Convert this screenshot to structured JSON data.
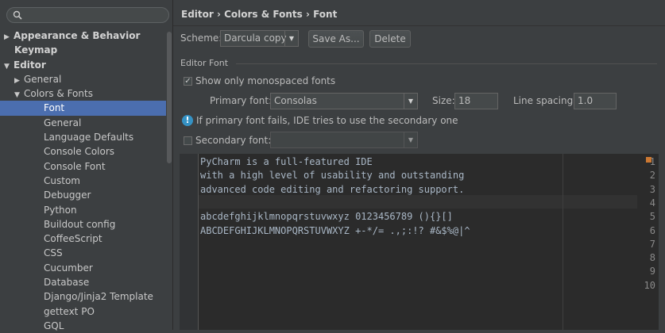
{
  "search": {
    "placeholder": ""
  },
  "tree": [
    {
      "label": "Appearance & Behavior",
      "level": 0,
      "arrow": "▶",
      "bold": true
    },
    {
      "label": "Keymap",
      "level": 0,
      "arrow": "",
      "bold": true
    },
    {
      "label": "Editor",
      "level": 0,
      "arrow": "▼",
      "bold": true
    },
    {
      "label": "General",
      "level": 1,
      "arrow": "▶"
    },
    {
      "label": "Colors & Fonts",
      "level": 1,
      "arrow": "▼"
    },
    {
      "label": "Font",
      "level": 2,
      "arrow": "",
      "selected": true
    },
    {
      "label": "General",
      "level": 2,
      "arrow": ""
    },
    {
      "label": "Language Defaults",
      "level": 2,
      "arrow": ""
    },
    {
      "label": "Console Colors",
      "level": 2,
      "arrow": ""
    },
    {
      "label": "Console Font",
      "level": 2,
      "arrow": ""
    },
    {
      "label": "Custom",
      "level": 2,
      "arrow": ""
    },
    {
      "label": "Debugger",
      "level": 2,
      "arrow": ""
    },
    {
      "label": "Python",
      "level": 2,
      "arrow": ""
    },
    {
      "label": "Buildout config",
      "level": 2,
      "arrow": ""
    },
    {
      "label": "CoffeeScript",
      "level": 2,
      "arrow": ""
    },
    {
      "label": "CSS",
      "level": 2,
      "arrow": ""
    },
    {
      "label": "Cucumber",
      "level": 2,
      "arrow": ""
    },
    {
      "label": "Database",
      "level": 2,
      "arrow": ""
    },
    {
      "label": "Django/Jinja2 Template",
      "level": 2,
      "arrow": ""
    },
    {
      "label": "gettext PO",
      "level": 2,
      "arrow": ""
    },
    {
      "label": "GQL",
      "level": 2,
      "arrow": ""
    }
  ],
  "breadcrumb": "Editor › Colors & Fonts › Font",
  "scheme": {
    "label": "Scheme:",
    "value": "Darcula copy",
    "save_as": "Save As...",
    "delete": "Delete"
  },
  "editor_font": {
    "section_title": "Editor Font",
    "monospaced_label": "Show only monospaced fonts",
    "monospaced_checked": true,
    "primary_label": "Primary font:",
    "primary_value": "Consolas",
    "size_label": "Size:",
    "size_value": "18",
    "spacing_label": "Line spacing:",
    "spacing_value": "1.0",
    "info_text": "If primary font fails, IDE tries to use the secondary one",
    "secondary_label": "Secondary font:",
    "secondary_value": ""
  },
  "preview_lines": [
    "PyCharm is a full-featured IDE",
    "with a high level of usability and outstanding",
    "advanced code editing and refactoring support.",
    "",
    "abcdefghijklmnopqrstuvwxyz 0123456789 (){}[]",
    "ABCDEFGHIJKLMNOPQRSTUVWXYZ +-*/= .,;:!? #&$%@|^",
    "",
    "",
    "",
    ""
  ],
  "line_numbers": [
    "1",
    "2",
    "3",
    "4",
    "5",
    "6",
    "7",
    "8",
    "9",
    "10"
  ],
  "colors": {
    "selection": "#4b6eaf",
    "background": "#3c3f41",
    "editor_bg": "#2b2b2b",
    "accent_marker": "#cc7832",
    "info": "#3592c4"
  }
}
